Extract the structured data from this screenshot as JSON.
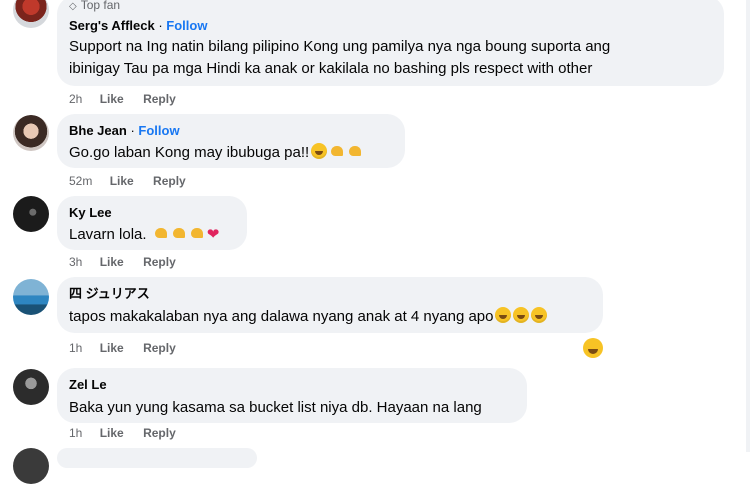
{
  "comments": [
    {
      "badge": "Top fan",
      "badge_icon": "diamond-icon",
      "name": "Serg's Affleck",
      "separator": "·",
      "follow": "Follow",
      "line1": "Support na Ing natin bilang pilipino Kong ung pamilya nya nga boung suporta ang",
      "line2": "ibinigay Tau pa mga Hindi ka anak or kakilala no bashing pls respect with other",
      "time": "2h",
      "like": "Like",
      "reply": "Reply"
    },
    {
      "name": "Bhe Jean",
      "separator": "·",
      "follow": "Follow",
      "text": "Go.go laban Kong may ibubuga pa!!",
      "emojis": [
        "smiling-face-icon",
        "flexed-biceps-icon",
        "flexed-biceps-icon"
      ],
      "time": "52m",
      "like": "Like",
      "reply": "Reply"
    },
    {
      "name": "Ky Lee",
      "text": "Lavarn lola.",
      "emojis": [
        "flexed-biceps-icon",
        "flexed-biceps-icon",
        "flexed-biceps-icon",
        "red-heart-icon"
      ],
      "time": "3h",
      "like": "Like",
      "reply": "Reply"
    },
    {
      "name": "四 ジュリアス",
      "text": "tapos makakalaban nya ang dalawa nyang anak at 4 nyang apo",
      "emojis": [
        "laughing-tears-icon",
        "laughing-tears-icon",
        "laughing-tears-icon"
      ],
      "time": "1h",
      "like": "Like",
      "reply": "Reply",
      "reaction": "laughing-tears-icon"
    },
    {
      "name": "Zel Le",
      "text": "Baka yun yung kasama sa bucket list niya db. Hayaan na lang",
      "time": "1h",
      "like": "Like",
      "reply": "Reply"
    }
  ],
  "colors": {
    "bubble": "#f0f2f5",
    "follow": "#1877f2",
    "meta": "#65676b",
    "text": "#050505"
  }
}
